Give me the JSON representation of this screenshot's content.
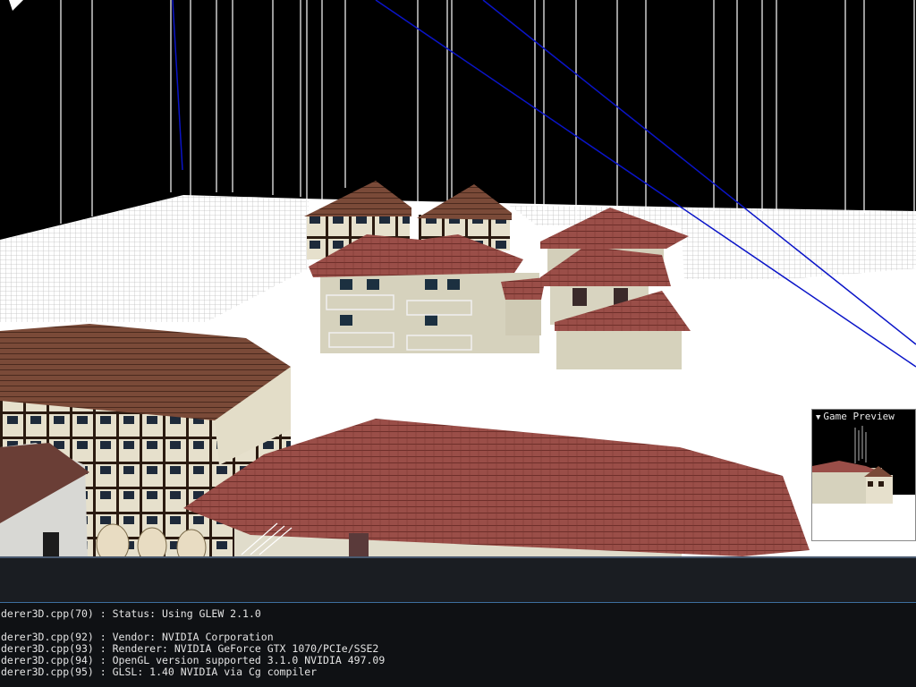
{
  "preview": {
    "title": "Game Preview",
    "collapse_glyph": "▼"
  },
  "console": {
    "lines": [
      "derer3D.cpp(70) : Status: Using GLEW 2.1.0",
      "",
      "derer3D.cpp(92) : Vendor: NVIDIA Corporation",
      "derer3D.cpp(93) : Renderer: NVIDIA GeForce GTX 1070/PCIe/SSE2",
      "derer3D.cpp(94) : OpenGL version supported 3.1.0 NVIDIA 497.09",
      "derer3D.cpp(95) : GLSL: 1.40 NVIDIA via Cg compiler"
    ]
  },
  "colors": {
    "sky": "#000000",
    "ground": "#ffffff",
    "grid": "#c8c8c8",
    "debug_line": "#0a14c8",
    "roof": "#9a4e48",
    "wall": "#d8d4c2",
    "timber": "#2a1a10",
    "console_bg": "#0f1114"
  },
  "icons": {
    "corner": "cursor-arrow-icon",
    "collapse": "collapse-triangle-icon"
  }
}
